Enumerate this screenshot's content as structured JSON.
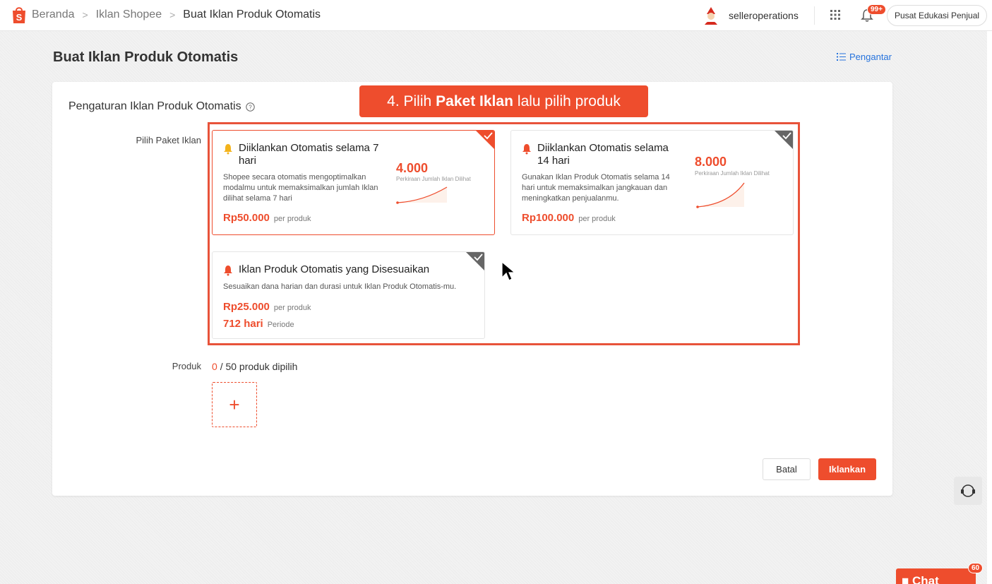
{
  "topbar": {
    "breadcrumbs": [
      "Beranda",
      "Iklan Shopee",
      "Buat Iklan Produk Otomatis"
    ],
    "username": "selleroperations",
    "notification_badge": "99+",
    "edu_button": "Pusat Edukasi Penjual"
  },
  "page": {
    "title": "Buat Iklan Produk Otomatis",
    "intro_link": "Pengantar"
  },
  "tooltip": {
    "prefix": "4. Pilih",
    "bold": "Paket Iklan",
    "suffix": "lalu pilih produk"
  },
  "form": {
    "section_title": "Pengaturan Iklan Produk Otomatis",
    "label_package": "Pilih Paket Iklan",
    "label_product": "Produk",
    "packages": [
      {
        "title": "Diiklankan Otomatis selama 7 hari",
        "description": "Shopee secara otomatis mengoptimalkan modalmu untuk memaksimalkan jumlah Iklan dilihat selama 7 hari",
        "price": "Rp50.000",
        "price_unit": "per produk",
        "estimate": "4.000",
        "estimate_label": "Perkiraan Jumlah Iklan Dilihat",
        "selected": true
      },
      {
        "title": "Diiklankan Otomatis selama 14 hari",
        "description": "Gunakan Iklan Produk Otomatis selama 14 hari untuk memaksimalkan jangkauan dan meningkatkan penjualanmu.",
        "price": "Rp100.000",
        "price_unit": "per produk",
        "estimate": "8.000",
        "estimate_label": "Perkiraan Jumlah Iklan Dilihat",
        "selected": false
      },
      {
        "title": "Iklan Produk Otomatis yang Disesuaikan",
        "description": "Sesuaikan dana harian dan durasi untuk Iklan Produk Otomatis-mu.",
        "price": "Rp25.000",
        "price_unit": "per produk",
        "period": "712 hari",
        "period_label": "Periode",
        "selected": false
      }
    ],
    "product_count_selected": "0",
    "product_count_rest": "/ 50 produk dipilih",
    "add_symbol": "+"
  },
  "actions": {
    "cancel": "Batal",
    "submit": "Iklankan"
  },
  "chat": {
    "label": "Chat",
    "badge": "60"
  },
  "colors": {
    "brand": "#ee4d2d",
    "link": "#2673dd"
  }
}
